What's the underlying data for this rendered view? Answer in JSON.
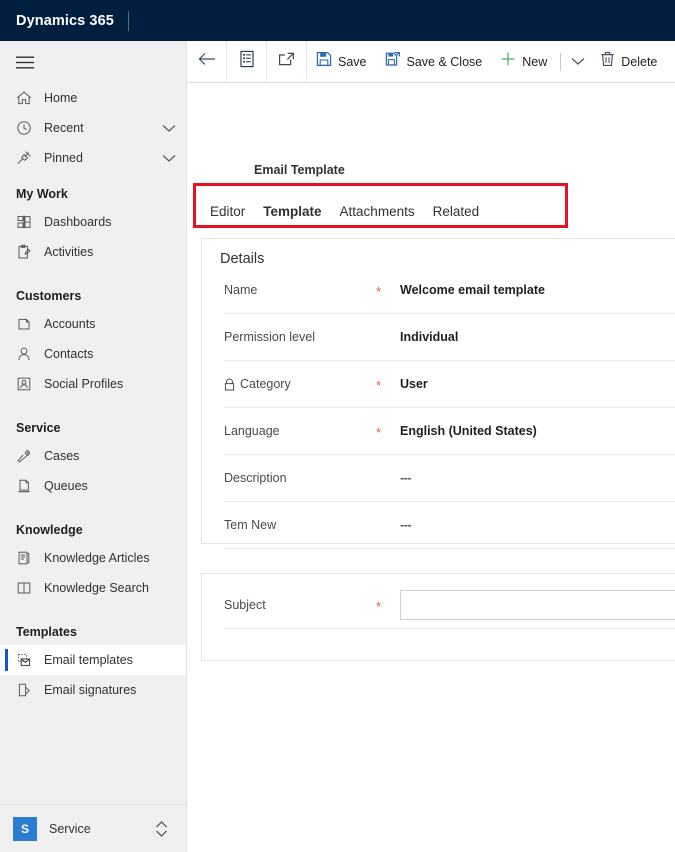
{
  "appbar": {
    "brand": "Dynamics 365"
  },
  "sidebar": {
    "hamburger_label": "site-map-menu",
    "top_items": [
      {
        "label": "Home",
        "icon": "home-icon",
        "chevron": false
      },
      {
        "label": "Recent",
        "icon": "clock-icon",
        "chevron": true
      },
      {
        "label": "Pinned",
        "icon": "pin-icon",
        "chevron": true
      }
    ],
    "groups": [
      {
        "title": "My Work",
        "items": [
          {
            "label": "Dashboards",
            "icon": "dashboard-icon",
            "selected": false
          },
          {
            "label": "Activities",
            "icon": "activities-icon",
            "selected": false
          }
        ]
      },
      {
        "title": "Customers",
        "items": [
          {
            "label": "Accounts",
            "icon": "accounts-icon",
            "selected": false
          },
          {
            "label": "Contacts",
            "icon": "contact-person-icon",
            "selected": false
          },
          {
            "label": "Social Profiles",
            "icon": "social-profile-icon",
            "selected": false
          }
        ]
      },
      {
        "title": "Service",
        "items": [
          {
            "label": "Cases",
            "icon": "case-briefcase-icon",
            "selected": false
          },
          {
            "label": "Queues",
            "icon": "queue-icon",
            "selected": false
          }
        ]
      },
      {
        "title": "Knowledge",
        "items": [
          {
            "label": "Knowledge Articles",
            "icon": "article-icon",
            "selected": false
          },
          {
            "label": "Knowledge Search",
            "icon": "book-search-icon",
            "selected": false
          }
        ]
      },
      {
        "title": "Templates",
        "items": [
          {
            "label": "Email templates",
            "icon": "email-template-icon",
            "selected": true
          },
          {
            "label": "Email signatures",
            "icon": "email-signature-icon",
            "selected": false
          }
        ]
      }
    ],
    "footer": {
      "badge": "S",
      "area": "Service",
      "switcher_icon": "up-down-chevron-icon"
    }
  },
  "commandbar": {
    "back_icon": "back-arrow-icon",
    "form_icon": "form-list-icon",
    "popout_icon": "open-in-new-window-icon",
    "save_label": "Save",
    "save_close_label": "Save & Close",
    "new_label": "New",
    "delete_label": "Delete",
    "overflow_icon": "chevron-down-icon"
  },
  "record": {
    "entity_label": "Email Template"
  },
  "tabs": [
    {
      "label": "Editor",
      "active": false
    },
    {
      "label": "Template",
      "active": true
    },
    {
      "label": "Attachments",
      "active": false
    },
    {
      "label": "Related",
      "active": false
    }
  ],
  "details": {
    "heading": "Details",
    "fields": [
      {
        "label": "Name",
        "required": true,
        "locked": false,
        "value": "Welcome email template"
      },
      {
        "label": "Permission level",
        "required": false,
        "locked": false,
        "value": "Individual"
      },
      {
        "label": "Category",
        "required": true,
        "locked": true,
        "value": "User"
      },
      {
        "label": "Language",
        "required": true,
        "locked": false,
        "value": "English (United States)"
      },
      {
        "label": "Description",
        "required": false,
        "locked": false,
        "value": "---"
      },
      {
        "label": "Tem New",
        "required": false,
        "locked": false,
        "value": "---"
      }
    ]
  },
  "subject_section": {
    "label": "Subject",
    "required": true,
    "value": "",
    "placeholder": ""
  },
  "colors": {
    "appbar_background": "#001f3f",
    "sidebar_background": "#f0f0f0",
    "accent_blue": "#2266cc",
    "selected_bar": "#0f5bbd",
    "required_star": "#e55c4a",
    "annotation_red": "#e81123",
    "save_icon_blue": "#2b6cb0",
    "new_icon_green": "#5fbf7f",
    "area_badge_blue": "#2b7cd3"
  },
  "annotation": {
    "name": "tab-strip-highlight",
    "shape": "rectangle",
    "color": "#e81123"
  }
}
